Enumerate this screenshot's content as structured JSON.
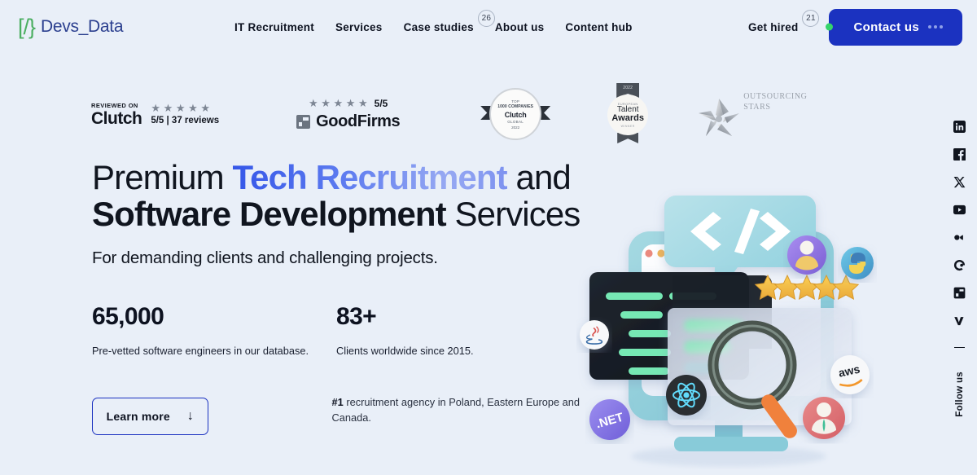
{
  "brand": {
    "logo_mark": "[/}",
    "logo_text": "Devs_Data",
    "logo_mark_color": "#4caf62",
    "logo_text_color": "#2b3f8f"
  },
  "header": {
    "nav": [
      {
        "label": "IT Recruitment",
        "badge": null
      },
      {
        "label": "Services",
        "badge": null
      },
      {
        "label": "Case studies",
        "badge": "26"
      },
      {
        "label": "About us",
        "badge": null
      },
      {
        "label": "Content hub",
        "badge": null
      }
    ],
    "get_hired": {
      "label": "Get hired",
      "badge": "21"
    },
    "contact_button": {
      "label": "Contact us",
      "bg_color": "#1b32c0",
      "dot_color": "#35d46a"
    }
  },
  "badges": {
    "clutch": {
      "reviewed_on": "REVIEWED ON",
      "name": "Clutch",
      "stars": "★ ★ ★ ★ ★",
      "rating": "5/5 | 37 reviews"
    },
    "goodfirms": {
      "stars": "★ ★ ★ ★ ★",
      "score": "5/5",
      "name": "GoodFirms"
    },
    "clutch_seal": {
      "line1": "TOP",
      "line2": "1000 COMPANIES",
      "line3": "Clutch",
      "line4": "GLOBAL",
      "line5": "2022"
    },
    "talent_awards": {
      "year": "2022",
      "sub": "EUROPEAN",
      "line1": "Talent",
      "line2": "Awards",
      "winner": "WINNER"
    },
    "outsourcing_stars": {
      "line1": "OUTSOURCING",
      "line2": "STARS"
    }
  },
  "hero": {
    "headline_part1": "Premium ",
    "headline_gradient": "Tech Recruitment",
    "headline_part2": " and",
    "headline_bold": "Software Development",
    "headline_part3": " Services",
    "subhead": "For demanding clients and challenging projects.",
    "stats": [
      {
        "number": "65,000",
        "description": "Pre-vetted software engineers in our database."
      },
      {
        "number": "83+",
        "description": "Clients worldwide since 2015."
      }
    ],
    "learn_more": {
      "label": "Learn more",
      "arrow": "↓"
    },
    "agency_note_strong": "#1",
    "agency_note_rest": " recruitment agency in Poland, Eastern Europe and Canada."
  },
  "social": {
    "icons": [
      "linkedin-icon",
      "facebook-icon",
      "x-twitter-icon",
      "youtube-icon",
      "video-camera-icon",
      "clutch-icon",
      "goodfirms-icon",
      "vimeo-icon"
    ],
    "follow_label": "Follow us"
  },
  "illustration": {
    "name": "tech-recruitment-3d-illustration",
    "code_glyph": "</>",
    "tech_badges": [
      ".NET",
      "java-icon",
      "react-icon",
      "aws",
      "python-icon"
    ],
    "stars_count": 5,
    "monitor_color": "#8fcdd8",
    "screen_color": "#eef3fb",
    "editor_color": "#171c24",
    "code_line_color": "#76e8b4"
  }
}
